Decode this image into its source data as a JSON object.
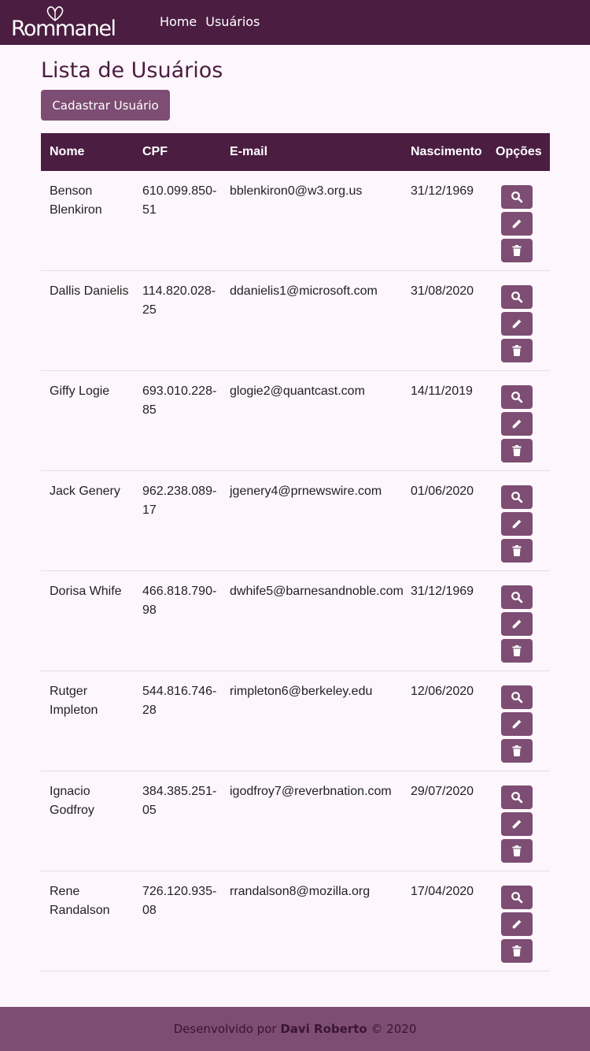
{
  "navbar": {
    "brand": "Rommanel",
    "links": [
      "Home",
      "Usuários"
    ]
  },
  "page": {
    "title": "Lista de Usuários",
    "add_button": "Cadastrar Usuário"
  },
  "table": {
    "headers": [
      "Nome",
      "CPF",
      "E-mail",
      "Nascimento",
      "Opções"
    ],
    "rows": [
      {
        "nome": "Benson Blenkiron",
        "cpf": "610.099.850-51",
        "email": "bblenkiron0@w3.org.us",
        "nascimento": "31/12/1969"
      },
      {
        "nome": "Dallis Danielis",
        "cpf": "114.820.028-25",
        "email": "ddanielis1@microsoft.com",
        "nascimento": "31/08/2020"
      },
      {
        "nome": "Giffy Logie",
        "cpf": "693.010.228-85",
        "email": "glogie2@quantcast.com",
        "nascimento": "14/11/2019"
      },
      {
        "nome": "Jack Genery",
        "cpf": "962.238.089-17",
        "email": "jgenery4@prnewswire.com",
        "nascimento": "01/06/2020"
      },
      {
        "nome": "Dorisa Whife",
        "cpf": "466.818.790-98",
        "email": "dwhife5@barnesandnoble.com",
        "nascimento": "31/12/1969"
      },
      {
        "nome": "Rutger Impleton",
        "cpf": "544.816.746-28",
        "email": "rimpleton6@berkeley.edu",
        "nascimento": "12/06/2020"
      },
      {
        "nome": "Ignacio Godfroy",
        "cpf": "384.385.251-05",
        "email": "igodfroy7@reverbnation.com",
        "nascimento": "29/07/2020"
      },
      {
        "nome": "Rene Randalson",
        "cpf": "726.120.935-08",
        "email": "rrandalson8@mozilla.org",
        "nascimento": "17/04/2020"
      }
    ],
    "option_icons": [
      "search-icon",
      "pencil-icon",
      "trash-icon"
    ]
  },
  "footer": {
    "prefix": "Desenvolvido por ",
    "author": "Davi Roberto",
    "suffix": " © 2020"
  },
  "colors": {
    "navbar": "#4b1d41",
    "accent": "#7d4d73",
    "background": "#fdf6fc"
  }
}
